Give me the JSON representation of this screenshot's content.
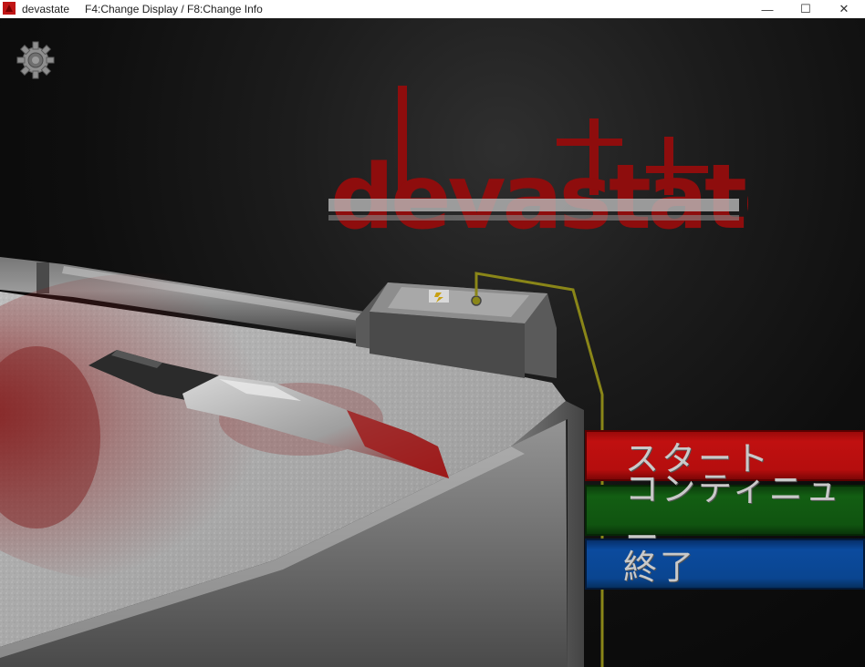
{
  "window": {
    "app_name": "devastate",
    "hint": "F4:Change Display / F8:Change Info",
    "minimize_glyph": "—",
    "maximize_glyph": "☐",
    "close_glyph": "✕"
  },
  "game": {
    "logo_text": "devastate",
    "settings_icon": "gear-icon",
    "menu": {
      "start_label": "スタート",
      "continue_label": "コンティニュー",
      "quit_label": "終了"
    },
    "colors": {
      "start": "#b50e0e",
      "continue": "#105410",
      "quit": "#0a4590",
      "logo_red": "#8e0d0d",
      "wire": "#8a8618"
    }
  }
}
